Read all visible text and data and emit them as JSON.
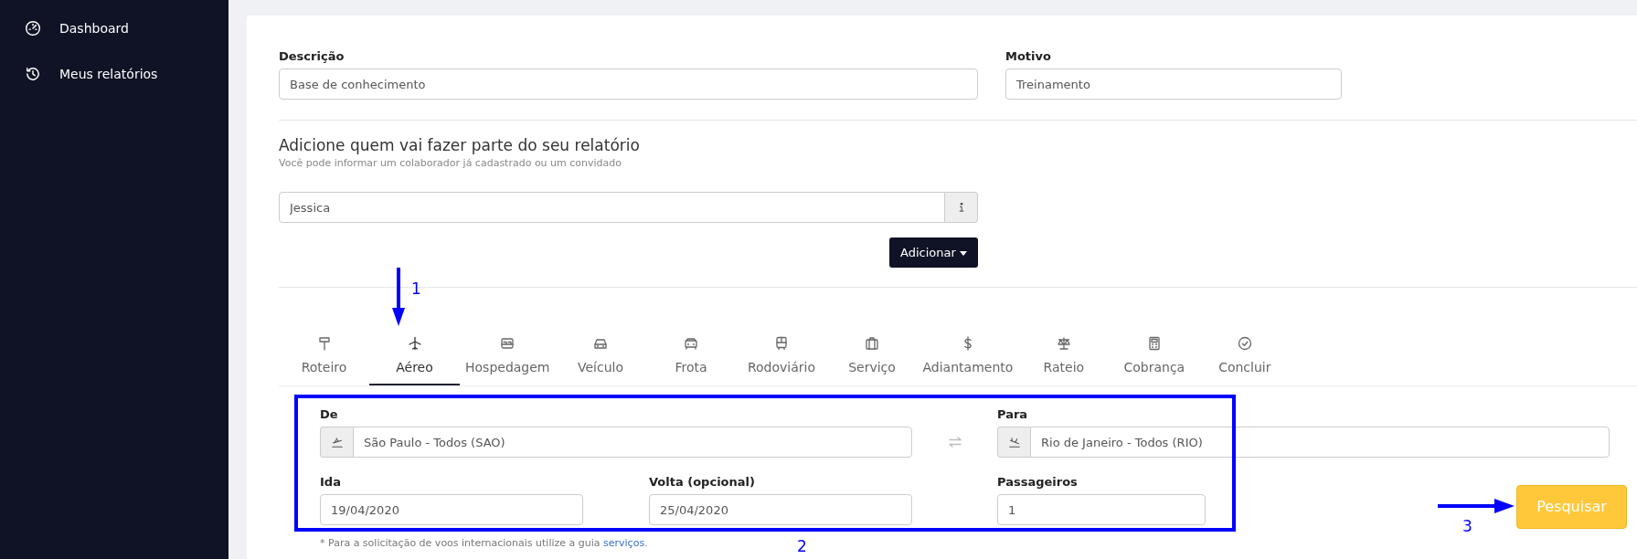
{
  "sidebar": {
    "items": [
      {
        "label": "Dashboard"
      },
      {
        "label": "Meus relatórios"
      }
    ]
  },
  "report": {
    "fields": [
      {
        "label": "Descrição",
        "value": "Base de conhecimento"
      },
      {
        "label": "Motivo",
        "value": "Treinamento"
      }
    ]
  },
  "participants": {
    "title": "Adicione quem vai fazer parte do seu relatório",
    "subtitle": "Você pode informar um colaborador já cadastrado ou um convidado",
    "value": "Jessica",
    "add_button": "Adicionar"
  },
  "tabs": [
    {
      "label": "Roteiro",
      "selected": false
    },
    {
      "label": "Aéreo",
      "selected": true
    },
    {
      "label": "Hospedagem",
      "selected": false
    },
    {
      "label": "Veículo",
      "selected": false
    },
    {
      "label": "Frota",
      "selected": false
    },
    {
      "label": "Rodoviário",
      "selected": false
    },
    {
      "label": "Serviço",
      "selected": false
    },
    {
      "label": "Adiantamento",
      "selected": false
    },
    {
      "label": "Rateio",
      "selected": false
    },
    {
      "label": "Cobrança",
      "selected": false
    },
    {
      "label": "Concluir",
      "selected": false
    }
  ],
  "flight": {
    "from": {
      "label": "De",
      "value": "São Paulo - Todos (SAO)"
    },
    "to": {
      "label": "Para",
      "value": "Rio de Janeiro - Todos (RIO)"
    },
    "departure": {
      "label": "Ida",
      "value": "19/04/2020"
    },
    "return": {
      "label": "Volta (opcional)",
      "value": "25/04/2020"
    },
    "passengers": {
      "label": "Passageiros",
      "value": "1"
    },
    "search_button": "Pesquisar",
    "note": {
      "text": "* Para a solicitação de voos internacionais utilize a guia ",
      "link": "serviços",
      "after": "."
    }
  },
  "annotations": [
    {
      "label": "1"
    },
    {
      "label": "2"
    },
    {
      "label": "3"
    }
  ]
}
